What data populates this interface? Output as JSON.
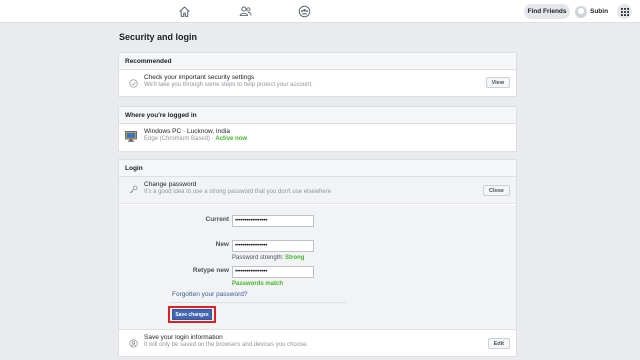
{
  "topbar": {
    "find_friends": "Find Friends",
    "profile_name": "Subin"
  },
  "page": {
    "title": "Security and login"
  },
  "recommended": {
    "header": "Recommended",
    "title": "Check your important security settings",
    "subtitle": "We'll take you through some steps to help protect your account.",
    "button": "View"
  },
  "logged_in": {
    "header": "Where you're logged in",
    "device": "Windows PC · Lucknow, India",
    "browser": "Edge (Chromium Based)",
    "separator": " · ",
    "status": "Active now"
  },
  "login": {
    "header": "Login",
    "change_password": {
      "title": "Change password",
      "subtitle": "It's a good idea to use a strong password that you don't use elsewhere",
      "close_button": "Close"
    },
    "form": {
      "current_label": "Current",
      "current_value": "•••••••••••••••••",
      "new_label": "New",
      "new_value": "•••••••••••••••••",
      "strength_label": "Password strength:",
      "strength_value": "Strong",
      "retype_label": "Retype new",
      "retype_value": "•••••••••••••••••",
      "match_text": "Passwords match",
      "forgot_link": "Forgotten your password?",
      "save_button": "Save changes"
    },
    "save_login": {
      "title": "Save your login information",
      "subtitle": "It will only be saved on the browsers and devices you choose.",
      "edit_button": "Edit"
    }
  },
  "colors": {
    "accent": "#4267b2",
    "success": "#42b72a",
    "highlight": "#e02020",
    "link": "#385898"
  },
  "icons": [
    "home-icon",
    "friends-icon",
    "groups-icon",
    "avatar",
    "apps-grid-icon",
    "checkmark-circle-icon",
    "monitor-icon",
    "key-icon",
    "person-circle-icon"
  ]
}
